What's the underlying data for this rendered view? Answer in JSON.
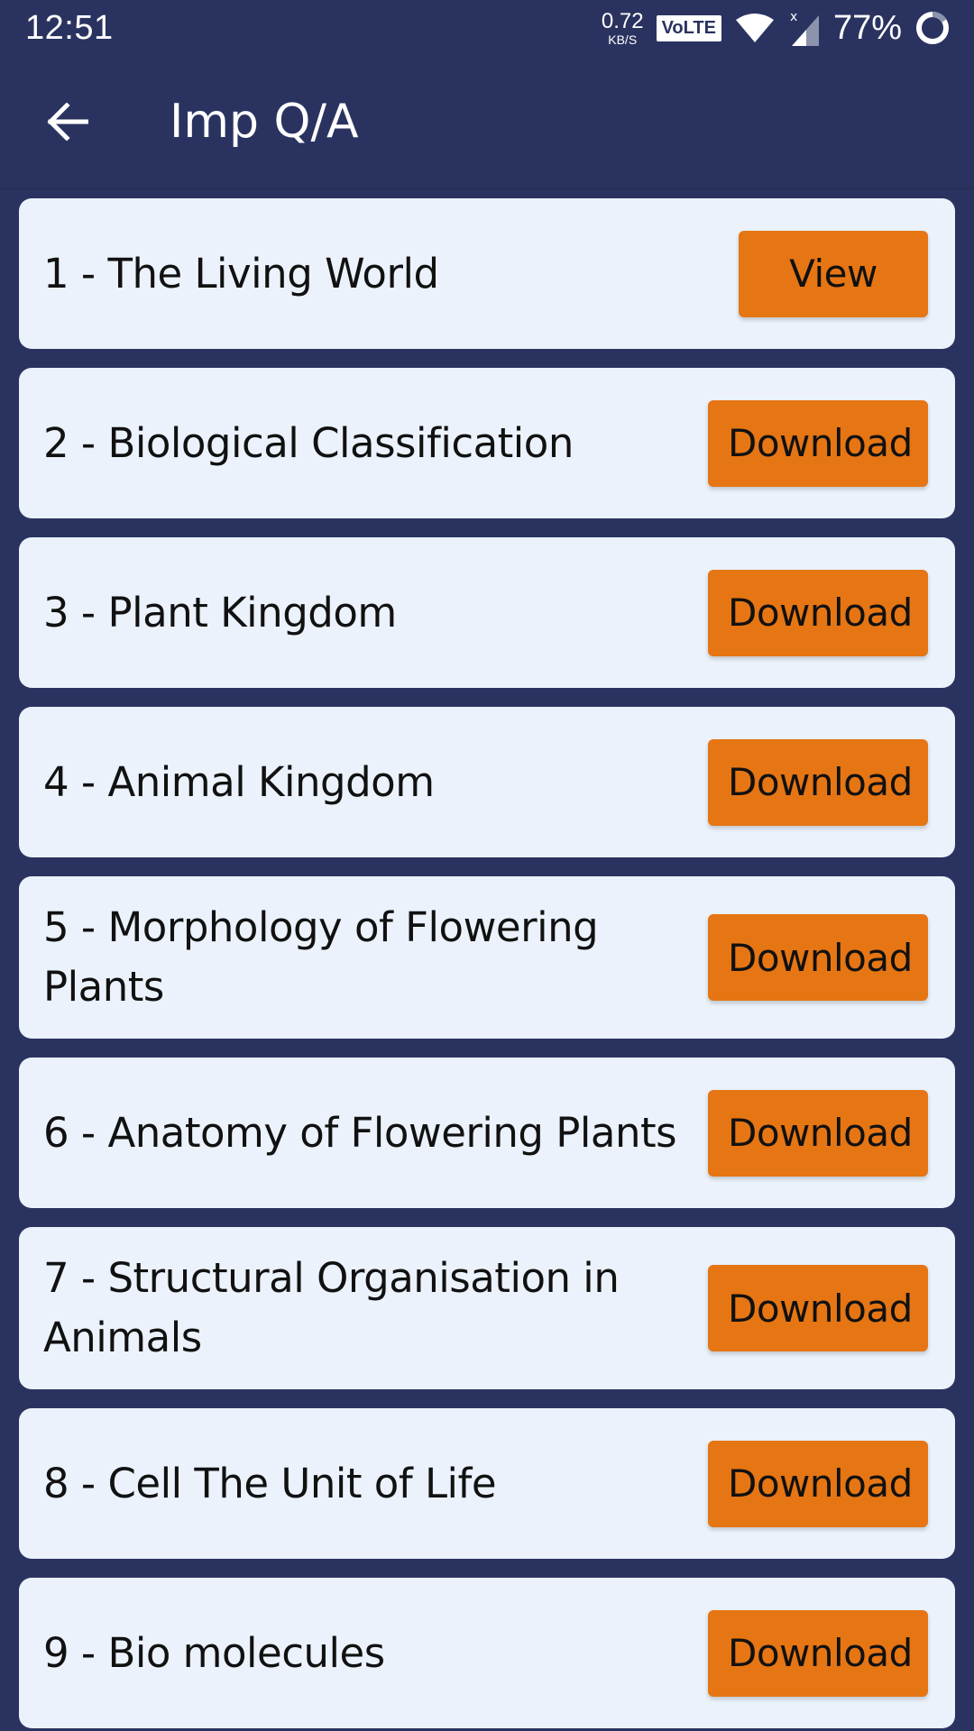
{
  "status_bar": {
    "time": "12:51",
    "net_speed_value": "0.72",
    "net_speed_unit": "KB/S",
    "volte": "VoLTE",
    "battery": "77%"
  },
  "app_bar": {
    "title": "Imp Q/A",
    "back_icon": "arrow-left-icon"
  },
  "colors": {
    "background": "#2a3360",
    "card": "#ebf2fb",
    "accent_button": "#e67514"
  },
  "items": [
    {
      "label": "1 - The Living World",
      "action": "View"
    },
    {
      "label": "2 - Biological Classification",
      "action": "Download"
    },
    {
      "label": "3 - Plant Kingdom",
      "action": "Download"
    },
    {
      "label": "4 - Animal Kingdom",
      "action": "Download"
    },
    {
      "label": "5 - Morphology of Flowering Plants",
      "action": "Download"
    },
    {
      "label": "6 - Anatomy of Flowering Plants",
      "action": "Download"
    },
    {
      "label": "7 - Structural Organisation in Animals",
      "action": "Download"
    },
    {
      "label": "8 - Cell The Unit of Life",
      "action": "Download"
    },
    {
      "label": "9 - Bio molecules",
      "action": "Download"
    }
  ]
}
